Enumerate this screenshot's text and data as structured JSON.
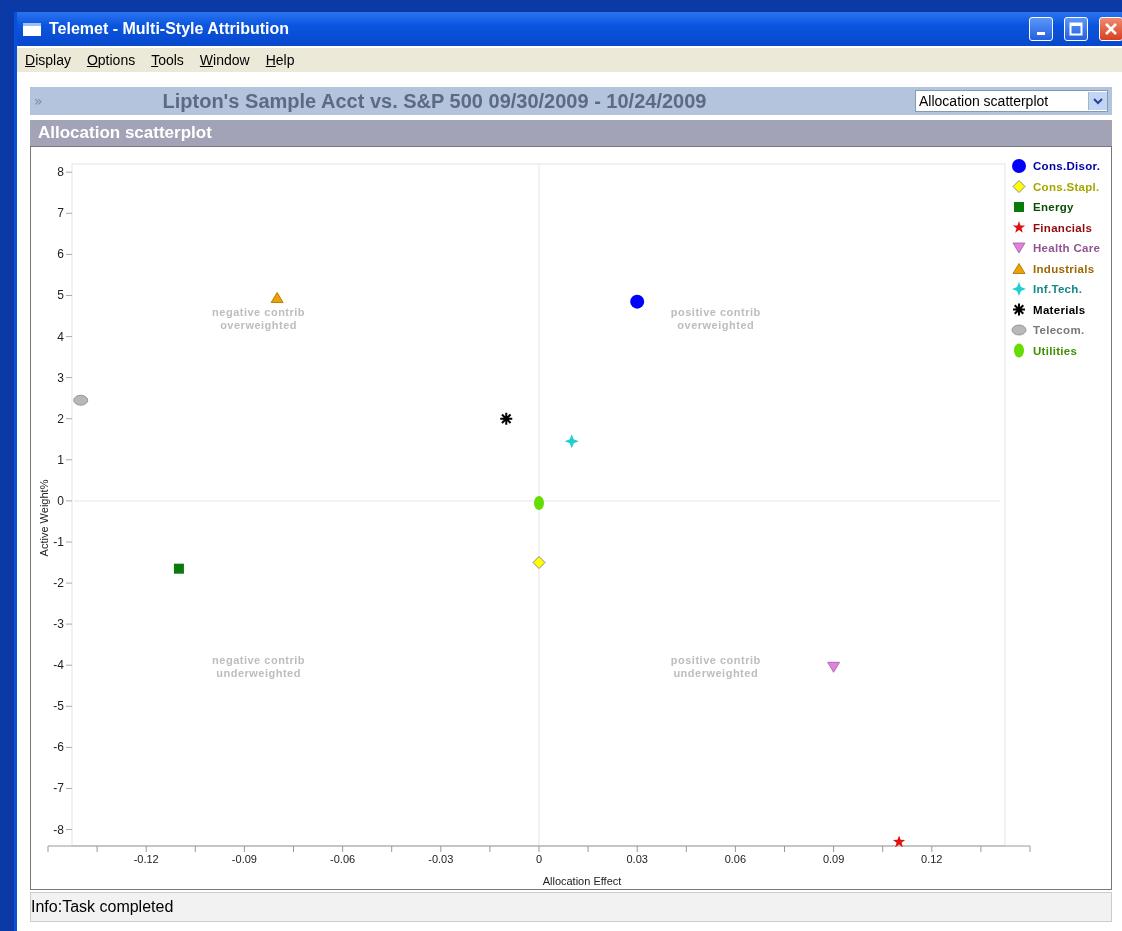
{
  "window": {
    "title": "Telemet - Multi-Style Attribution"
  },
  "menu": [
    {
      "label": "Display"
    },
    {
      "label": "Options"
    },
    {
      "label": "Tools"
    },
    {
      "label": "Window"
    },
    {
      "label": "Help"
    }
  ],
  "header": {
    "expander": "»",
    "title": "Lipton's Sample Acct vs. S&P 500 09/30/2009 - 10/24/2009",
    "dropdown": {
      "value": "Allocation scatterplot"
    }
  },
  "section": {
    "title": "Allocation scatterplot"
  },
  "chart_data": {
    "type": "scatter",
    "xlabel": "Allocation Effect",
    "ylabel": "Active Weight%",
    "xlim": [
      -0.15,
      0.15
    ],
    "ylim": [
      -8.4,
      8.2
    ],
    "xticks": [
      {
        "value": -0.12,
        "label": "-0.12"
      },
      {
        "value": -0.09,
        "label": "-0.09"
      },
      {
        "value": -0.06,
        "label": "-0.06"
      },
      {
        "value": -0.03,
        "label": "-0.03"
      },
      {
        "value": 0,
        "label": "0"
      },
      {
        "value": 0.03,
        "label": "0.03"
      },
      {
        "value": 0.06,
        "label": "0.06"
      },
      {
        "value": 0.09,
        "label": "0.09"
      },
      {
        "value": 0.12,
        "label": "0.12"
      }
    ],
    "yticks": [
      8,
      7,
      6,
      5,
      4,
      3,
      2,
      1,
      0,
      -1,
      -2,
      -3,
      -4,
      -5,
      -6,
      -7,
      -8
    ],
    "legend": true,
    "series": [
      {
        "name": "Cons.Disor.",
        "color": "#0000ff",
        "x": [
          0.03
        ],
        "values": [
          4.85
        ]
      },
      {
        "name": "Cons.Stapl.",
        "color": "#ffff00",
        "x": [
          0
        ],
        "values": [
          -1.5
        ]
      },
      {
        "name": "Energy",
        "color": "#0a7a0a",
        "x": [
          -0.11
        ],
        "values": [
          -1.65
        ]
      },
      {
        "name": "Financials",
        "color": "#e01010",
        "x": [
          0.11
        ],
        "values": [
          -8.3
        ]
      },
      {
        "name": "Health Care",
        "color": "#e080e0",
        "x": [
          0.09
        ],
        "values": [
          -4.05
        ]
      },
      {
        "name": "Industrials",
        "color": "#f0a000",
        "x": [
          -0.08
        ],
        "values": [
          4.95
        ]
      },
      {
        "name": "Inf.Tech.",
        "color": "#20d0d0",
        "x": [
          0.01
        ],
        "values": [
          1.45
        ]
      },
      {
        "name": "Materials",
        "color": "#000000",
        "x": [
          -0.01
        ],
        "values": [
          2.0
        ]
      },
      {
        "name": "Telecom.",
        "color": "#b8b8b8",
        "x": [
          -0.14
        ],
        "values": [
          2.45
        ]
      },
      {
        "name": "Utilities",
        "color": "#66dd00",
        "x": [
          0
        ],
        "values": [
          -0.05
        ]
      }
    ],
    "annotations": [
      "negative contrib\noverweighted",
      "positive contrib\noverweighted",
      "negative contrib\nunderweighted",
      "positive contrib\nunderweighted"
    ]
  },
  "markers": [
    {
      "kind": "circle"
    },
    {
      "kind": "diamond"
    },
    {
      "kind": "square"
    },
    {
      "kind": "star"
    },
    {
      "kind": "triangle-down"
    },
    {
      "kind": "triangle"
    },
    {
      "kind": "cross"
    },
    {
      "kind": "asterisk"
    },
    {
      "kind": "ellipse"
    },
    {
      "kind": "oval"
    }
  ],
  "status_bar": {
    "text": "Info:Task completed"
  }
}
